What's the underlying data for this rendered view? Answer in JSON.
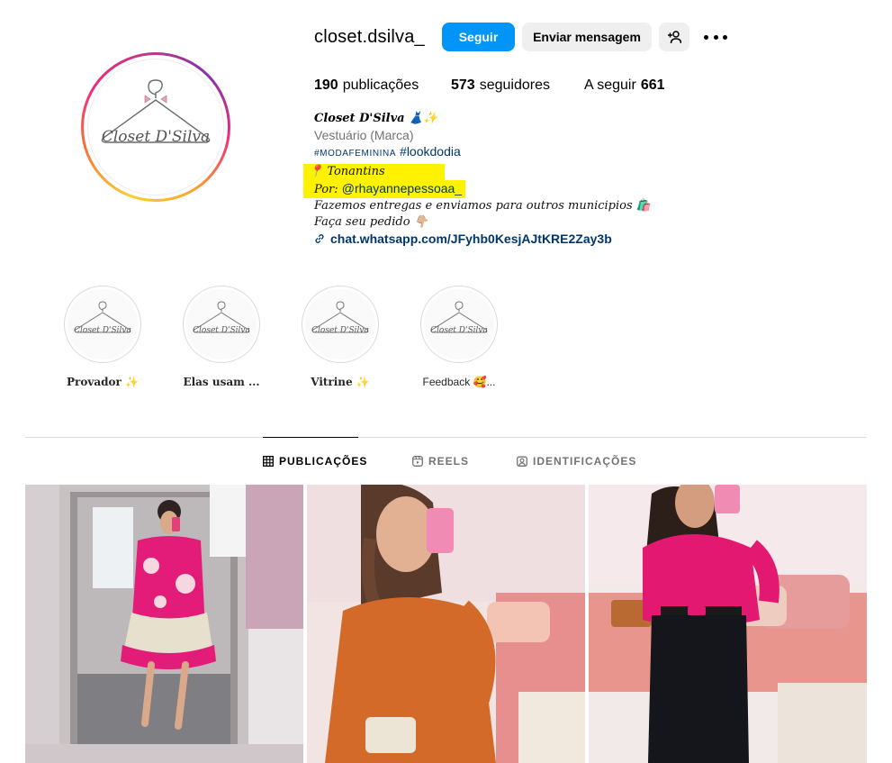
{
  "profile": {
    "username": "closet.dsilva_",
    "follow_label": "Seguir",
    "message_label": "Enviar mensagem",
    "logo_text": "Closet D'Silva"
  },
  "stats": {
    "posts_count": "190",
    "posts_label": "publicações",
    "followers_count": "573",
    "followers_label": "seguidores",
    "following_label": "A seguir",
    "following_count": "661"
  },
  "bio": {
    "name": "Closet D'Silva 👗✨",
    "category": "Vestuário (Marca)",
    "hashtag1": "#modafeminina",
    "hashtag2": "#lookdodia",
    "location": "📍 Tonantins",
    "by_prefix": "Por: ",
    "by_handle": "@rhayannepessoaa_",
    "line_delivery": "Fazemos entregas e enviamos para outros municipios 🛍️",
    "line_order": "Faça seu pedido 👇🏼",
    "link": "chat.whatsapp.com/JFyhb0KesjAJtKRE2Zay3b",
    "highlight_color": "#fff200"
  },
  "highlights": [
    {
      "label": "Provador ✨"
    },
    {
      "label": "Elas usam ..."
    },
    {
      "label": "Vitrine ✨"
    },
    {
      "label": "Feedback 🥰..."
    }
  ],
  "tabs": [
    {
      "label": "PUBLICAÇÕES",
      "icon": "grid-icon",
      "active": true
    },
    {
      "label": "REELS",
      "icon": "reels-icon",
      "active": false
    },
    {
      "label": "IDENTIFICAÇÕES",
      "icon": "tagged-icon",
      "active": false
    }
  ],
  "colors": {
    "primary_button": "#0095f6",
    "secondary_button": "#efefef",
    "link": "#00376b",
    "muted": "#737373"
  }
}
